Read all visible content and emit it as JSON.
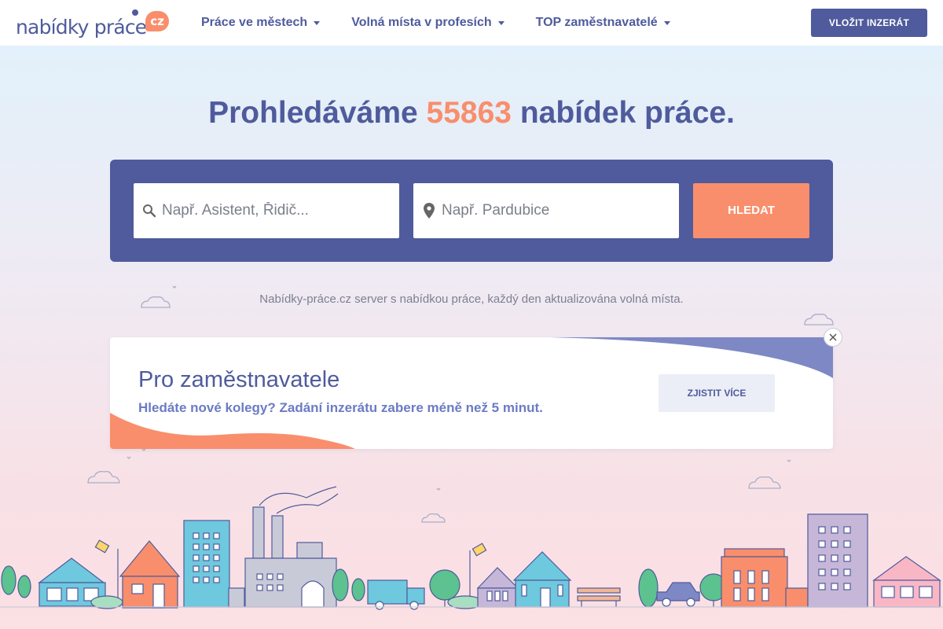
{
  "header": {
    "logo_text": "nabídky práce",
    "logo_badge": "cz",
    "nav": [
      {
        "label": "Práce ve městech"
      },
      {
        "label": "Volná místa v profesích"
      },
      {
        "label": "TOP zaměstnavatelé"
      }
    ],
    "post_button": "VLOŽIT INZERÁT"
  },
  "hero": {
    "title_prefix": "Prohledáváme ",
    "count": "55863",
    "title_suffix": " nabídek práce.",
    "search": {
      "query_placeholder": "Např. Asistent, Řidič...",
      "location_placeholder": "Např. Pardubice",
      "button": "HLEDAT"
    },
    "tagline": "Nabídky-práce.cz server s nabídkou práce, každý den aktualizována volná místa."
  },
  "promo": {
    "title": "Pro zaměstnavatele",
    "subtitle": "Hledáte nové kolegy? Zadání inzerátu zabere méně než 5 minut.",
    "button": "ZJISTIT VÍCE"
  },
  "colors": {
    "primary": "#4f5b9c",
    "accent": "#f98e6c",
    "secondary_text": "#6b7bc4"
  },
  "icons": [
    "search-icon",
    "location-pin-icon",
    "close-icon",
    "caret-down-icon"
  ]
}
